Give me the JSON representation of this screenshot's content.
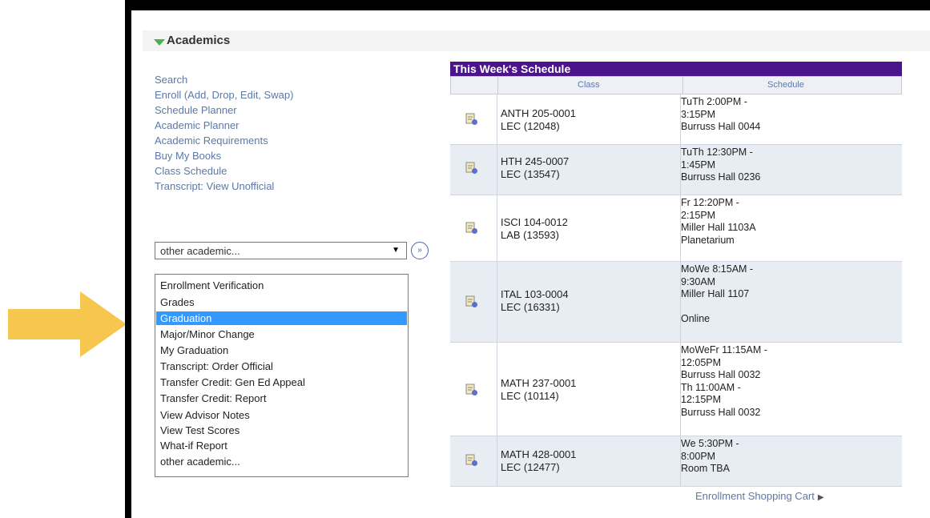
{
  "colors": {
    "arrow": "#f7c64f",
    "schedule_header": "#4b148a",
    "link": "#5b79a8",
    "selected_option": "#3399ff"
  },
  "section": {
    "title": "Academics",
    "toggle_icon": "triangle-down-icon"
  },
  "links": [
    "Search",
    "Enroll (Add, Drop, Edit, Swap)",
    "Schedule Planner",
    "Academic Planner",
    "Academic Requirements",
    "Buy My Books",
    "Class Schedule",
    "Transcript: View Unofficial"
  ],
  "select": {
    "value": "other academic...",
    "caret_icon": "dropdown-caret-icon",
    "go_icon": "double-chevron-right-icon"
  },
  "dropdown": {
    "options": [
      "Enrollment Verification",
      "Grades",
      "Graduation",
      "Major/Minor Change",
      "My Graduation",
      "Transcript: Order Official",
      "Transfer Credit: Gen Ed Appeal",
      "Transfer Credit: Report",
      "View Advisor Notes",
      "View Test Scores",
      "What-if Report",
      "other academic..."
    ],
    "selected": "Graduation"
  },
  "schedule": {
    "title": "This Week's Schedule",
    "col_class": "Class",
    "col_schedule": "Schedule",
    "rows": [
      {
        "course": "ANTH 205-0001",
        "section": "LEC (12048)",
        "times": [
          "TuTh 2:00PM -",
          "3:15PM",
          "Burruss Hall 0044"
        ]
      },
      {
        "course": "HTH 245-0007",
        "section": "LEC (13547)",
        "times": [
          "TuTh 12:30PM -",
          "1:45PM",
          "Burruss Hall 0236"
        ]
      },
      {
        "course": "ISCI 104-0012",
        "section": "LAB (13593)",
        "times": [
          "Fr 12:20PM -",
          "2:15PM",
          "Miller Hall 1103A",
          "Planetarium"
        ]
      },
      {
        "course": "ITAL 103-0004",
        "section": "LEC (16331)",
        "times": [
          "MoWe 8:15AM -",
          "9:30AM",
          "Miller Hall 1107",
          "",
          "Online"
        ]
      },
      {
        "course": "MATH 237-0001",
        "section": "LEC (10114)",
        "times": [
          "MoWeFr 11:15AM -",
          "12:05PM",
          "Burruss Hall 0032",
          "Th 11:00AM -",
          "12:15PM",
          "Burruss Hall 0032"
        ]
      },
      {
        "course": "MATH 428-0001",
        "section": "LEC (12477)",
        "times": [
          "We 5:30PM -",
          "8:00PM",
          "Room  TBA"
        ]
      }
    ],
    "row_icon": "class-details-icon"
  },
  "cart_link": {
    "label": "Enrollment Shopping Cart",
    "icon": "triangle-right-icon"
  }
}
